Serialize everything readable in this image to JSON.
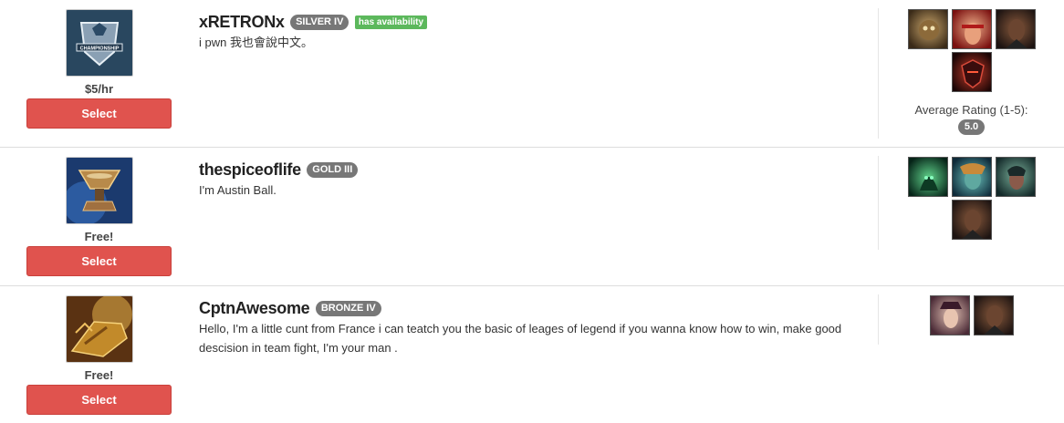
{
  "coaches": [
    {
      "username": "xRETRONx",
      "rank": "SILVER IV",
      "availability": "has availability",
      "bio": "i pwn 我也會說中文。",
      "price": "$5/hr",
      "select_label": "Select",
      "avatar_icon": "worlds-championship-icon",
      "avatar_text": "CHAMPIONSHIP",
      "champions": [
        "rammus-icon",
        "lee-sin-icon",
        "lucian-icon",
        "zed-icon"
      ],
      "rating_label": "Average Rating (1-5):",
      "rating": "5.0"
    },
    {
      "username": "thespiceoflife",
      "rank": "GOLD III",
      "bio": "I'm Austin Ball.",
      "price": "Free!",
      "select_label": "Select",
      "avatar_icon": "hourglass-chalice-icon",
      "champions": [
        "thresh-icon",
        "nami-icon",
        "karma-icon",
        "lucian-icon"
      ]
    },
    {
      "username": "CptnAwesome",
      "rank": "BRONZE IV",
      "bio": "Hello, I'm a little cunt from France i can teatch you the basic of leages of legend if you wanna know how to win, make good descision in team fight, I'm your man .",
      "price": "Free!",
      "select_label": "Select",
      "avatar_icon": "golden-gauntlet-icon",
      "champions": [
        "caitlyn-icon",
        "lucian-icon"
      ]
    }
  ],
  "colors": {
    "select_button": "#e0534e",
    "rank_badge": "#777777",
    "availability_badge": "#5cb85c"
  }
}
